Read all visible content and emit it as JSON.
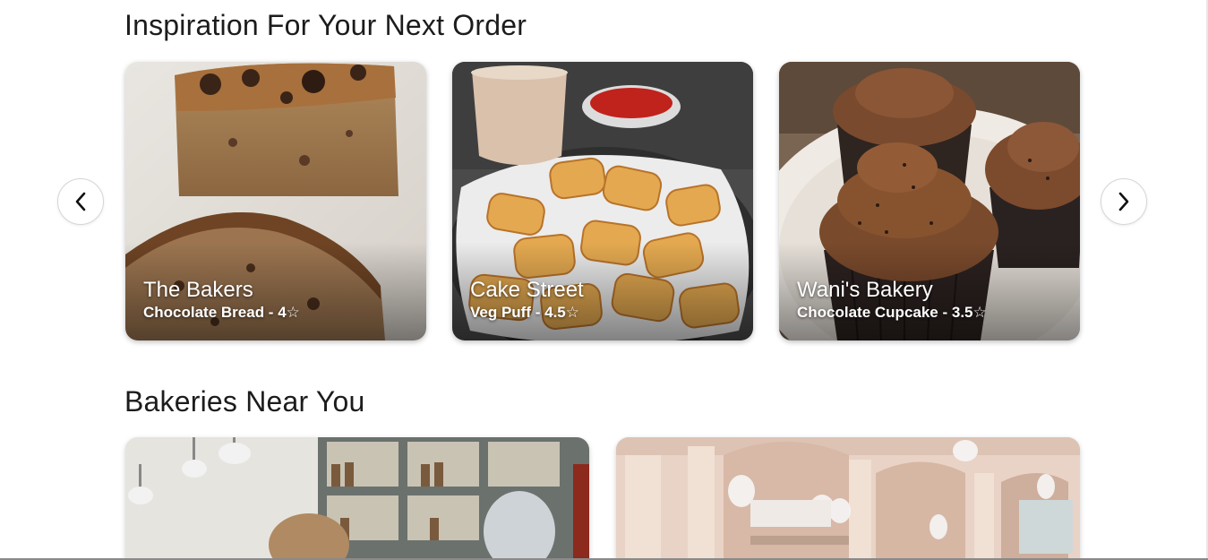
{
  "inspiration": {
    "title": "Inspiration For Your Next Order",
    "prev_label": "‹",
    "next_label": "›",
    "cards": [
      {
        "name": "The Bakers",
        "subtitle": "Chocolate Bread - 4☆"
      },
      {
        "name": "Cake Street",
        "subtitle": "Veg Puff - 4.5☆"
      },
      {
        "name": "Wani's Bakery",
        "subtitle": "Chocolate Cupcake - 3.5☆"
      }
    ]
  },
  "nearby": {
    "title": "Bakeries Near You"
  }
}
